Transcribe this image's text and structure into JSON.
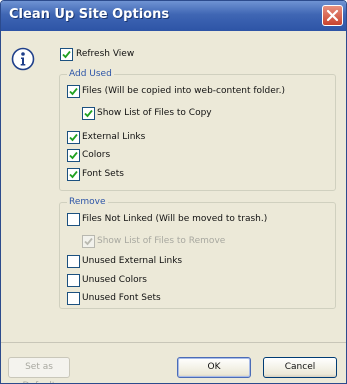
{
  "window": {
    "title": "Clean Up Site Options"
  },
  "options": {
    "refresh_view": {
      "label": "Refresh View",
      "checked": true
    }
  },
  "add_used": {
    "heading": "Add Used",
    "items": [
      {
        "label": "Files (Will be copied into web-content folder.)",
        "checked": true
      },
      {
        "label": "Show List of Files to Copy",
        "checked": true
      },
      {
        "label": "External Links",
        "checked": true
      },
      {
        "label": "Colors",
        "checked": true
      },
      {
        "label": "Font Sets",
        "checked": true
      }
    ]
  },
  "remove": {
    "heading": "Remove",
    "items": [
      {
        "label": "Files Not Linked (Will be moved to trash.)",
        "checked": false
      },
      {
        "label": "Show List of Files to Remove",
        "checked": true,
        "disabled": true
      },
      {
        "label": "Unused External Links",
        "checked": false
      },
      {
        "label": "Unused Colors",
        "checked": false
      },
      {
        "label": "Unused Font Sets",
        "checked": false
      }
    ]
  },
  "buttons": {
    "set_default": "Set as Default",
    "ok": "OK",
    "cancel": "Cancel"
  },
  "colors": {
    "titlebar": "#2d54a6",
    "group_heading": "#2e56a8",
    "checkmark": "#21a121"
  },
  "icons": {
    "info": "info-icon",
    "close": "close-icon",
    "check": "checkmark-icon"
  }
}
